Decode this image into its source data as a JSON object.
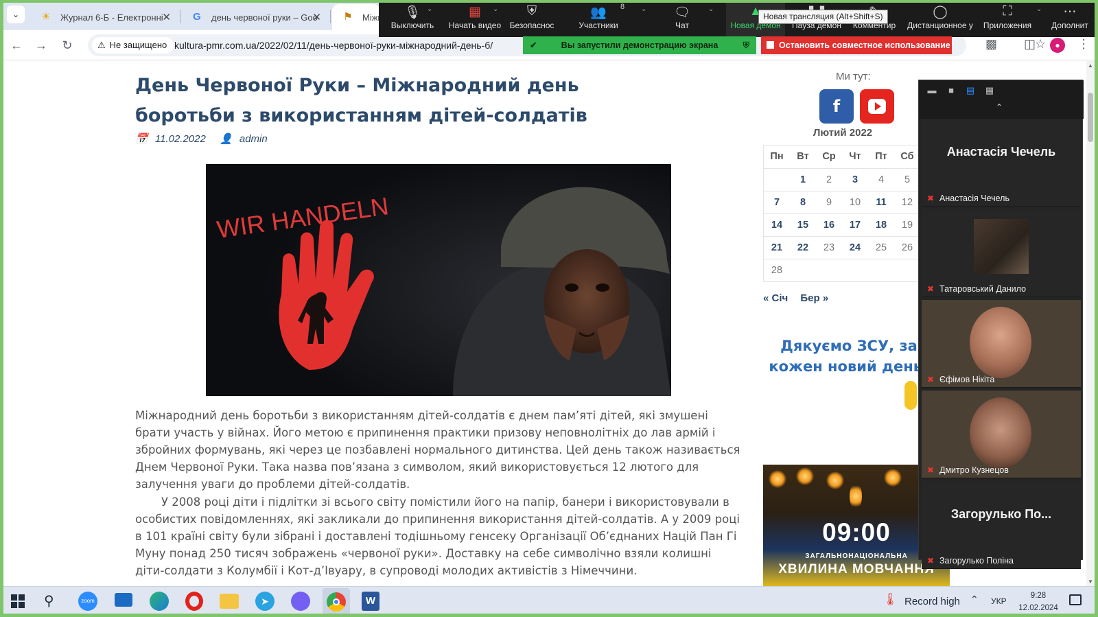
{
  "browser": {
    "tabs": [
      {
        "title": "Журнал 6-Б - Електронні",
        "favicon": "sun-icon"
      },
      {
        "title": "день червоної руки – Goo",
        "favicon": "google-g-icon"
      },
      {
        "title": "Міжн",
        "favicon": "site-icon"
      }
    ],
    "security_label": "Не защищено",
    "url": "kultura-pmr.com.ua/2022/02/11/день-червоної-руки-міжнародний-день-б/"
  },
  "zoom": {
    "buttons": {
      "mute": "Выключить",
      "video": "Начать видео",
      "security": "Безопаснос",
      "participants": "Участники",
      "participants_count": "8",
      "chat": "Чат",
      "new_share": "Новая демон",
      "pause_share": "Пауза демон",
      "annotate": "Комментир",
      "remote_control": "Дистанционное у",
      "apps": "Приложения",
      "more": "Дополнит"
    },
    "tooltip": "Новая трансляция (Alt+Shift+S)",
    "share_banner": "Вы запустили демонстрацию экрана",
    "stop_share": "Остановить совместное использование",
    "participants": [
      {
        "big_name": "Анастасія Чечель",
        "name": "Анастасія Чечель",
        "type": "name"
      },
      {
        "big_name": "",
        "name": "Татаровський Данило",
        "type": "photo"
      },
      {
        "big_name": "",
        "name": "Єфімов Нікіта",
        "type": "video"
      },
      {
        "big_name": "",
        "name": "Дмитро Кузнецов",
        "type": "video"
      },
      {
        "big_name": "Загорулько По...",
        "name": "Загорулько Поліна",
        "type": "name"
      }
    ]
  },
  "article": {
    "title": "День Червоної Руки – Міжнародний день боротьби з використанням дітей-солдатів",
    "date": "11.02.2022",
    "author": "admin",
    "image_text": "WIR HANDELN",
    "paragraph1": "Міжнародний день боротьби з використанням дітей-солдатів є днем пам’яті дітей, які змушені брати участь у війнах. Його метою є припинення практики призову неповнолітніх до лав армій і збройних формувань, які через це позбавлені нормального дитинства. Цей день також називається Днем Червоної Руки. Така назва пов’язана з символом, який використовується 12 лютого для залучення уваги до проблеми дітей-солдатів.",
    "paragraph2": "У 2008 році діти і підлітки зі всього світу помістили його на папір, банери і використовували в особистих повідомленнях, які закликали до припинення використання дітей-солдатів. А у 2009 році в 101 країні світу були зібрані і доставлені тодішньому генсеку Організації Об’єднаних Націй Пан Гі Муну понад 250 тисяч зображень «червоної руки». Доставку на себе символічно взяли колишні діти-солдати з Колумбії і Кот-д’Івуару, в супроводі молодих активістів з Німеччини."
  },
  "sidebar": {
    "we_are_here": "Ми тут:",
    "facebook_glyph": "f",
    "calendar": {
      "caption": "Лютий 2022",
      "weekdays": [
        "Пн",
        "Вт",
        "Ср",
        "Чт",
        "Пт",
        "Сб"
      ],
      "rows": [
        [
          "",
          "1",
          "2",
          "3",
          "4",
          "5"
        ],
        [
          "7",
          "8",
          "9",
          "10",
          "11",
          "12"
        ],
        [
          "14",
          "15",
          "16",
          "17",
          "18",
          "19"
        ],
        [
          "21",
          "22",
          "23",
          "24",
          "25",
          "26"
        ],
        [
          "28",
          "",
          "",
          "",
          "",
          ""
        ]
      ],
      "linked_days": [
        "1",
        "3",
        "7",
        "8",
        "11",
        "14",
        "15",
        "16",
        "17",
        "18",
        "21",
        "22",
        "24"
      ],
      "prev": "« Січ",
      "next": "Бер »"
    },
    "thanks_banner": "Дякуємо ЗСУ, за кожен новий день!",
    "memorial": {
      "time": "09:00",
      "line1": "ЗАГАЛЬНОНАЦІОНАЛЬНА",
      "line2": "ХВИЛИНА МОВЧАННЯ"
    }
  },
  "taskbar": {
    "record_label": "Record high",
    "language": "УКР",
    "time": "9:28",
    "date": "12.02.2024",
    "zoom_label": "zoom"
  }
}
